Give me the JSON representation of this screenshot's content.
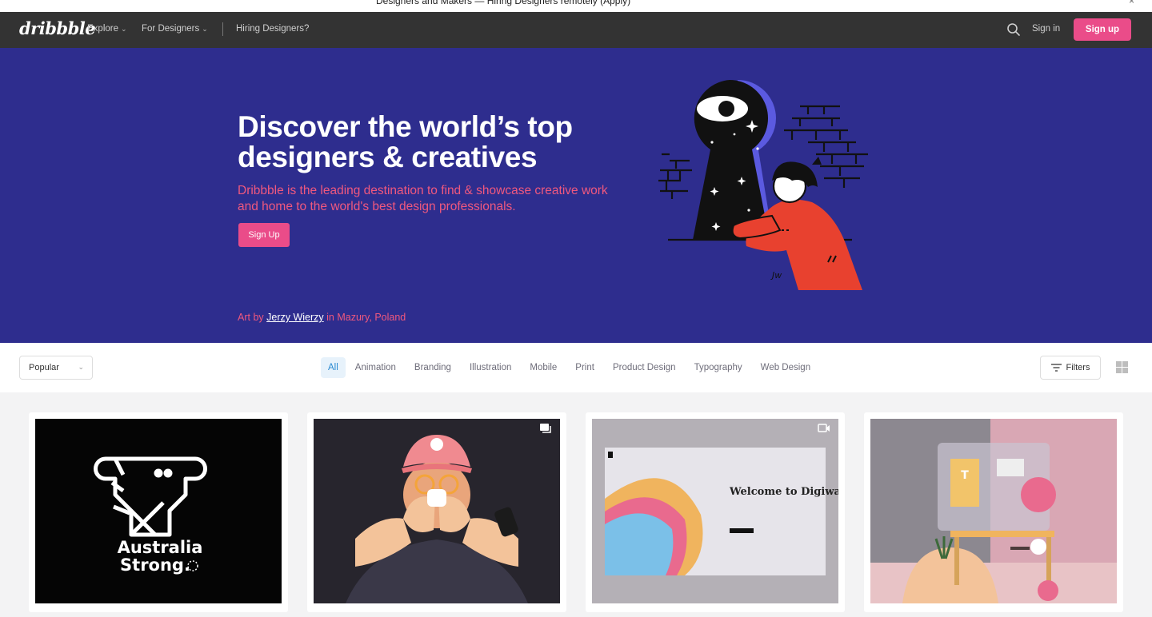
{
  "top_strip": {
    "text": "Designers and Makers — Hiring Designers remotely (Apply)",
    "close": "×"
  },
  "nav": {
    "logo": "dribbble",
    "explore": "Explore",
    "for_designers": "For Designers",
    "hiring": "Hiring Designers?",
    "sign_in": "Sign in",
    "sign_up": "Sign up"
  },
  "hero": {
    "title": "Discover the world’s top designers & creatives",
    "subtitle": "Dribbble is the leading destination to find & showcase creative work and home to the world's best design professionals.",
    "button": "Sign Up",
    "credit_prefix": "Art by ",
    "credit_artist": "Jerzy Wierzy",
    "credit_suffix": " in Mazury, Poland",
    "colors": {
      "background": "#2e2d8e",
      "accent": "#f0587e",
      "button": "#ea4c89"
    }
  },
  "filters": {
    "sort": "Popular",
    "categories": [
      "All",
      "Animation",
      "Branding",
      "Illustration",
      "Mobile",
      "Print",
      "Product Design",
      "Typography",
      "Web Design"
    ],
    "active_category": "All",
    "filters_button": "Filters"
  },
  "shots": [
    {
      "name": "australia-strong",
      "lines": [
        "Australia",
        "Strong."
      ],
      "badge": null
    },
    {
      "name": "3d-character",
      "badge": "multi-shot-icon"
    },
    {
      "name": "digiwall",
      "heading": "Welcome to Digiwall",
      "badge": "video-icon"
    },
    {
      "name": "desk-scene",
      "badge": null
    }
  ]
}
